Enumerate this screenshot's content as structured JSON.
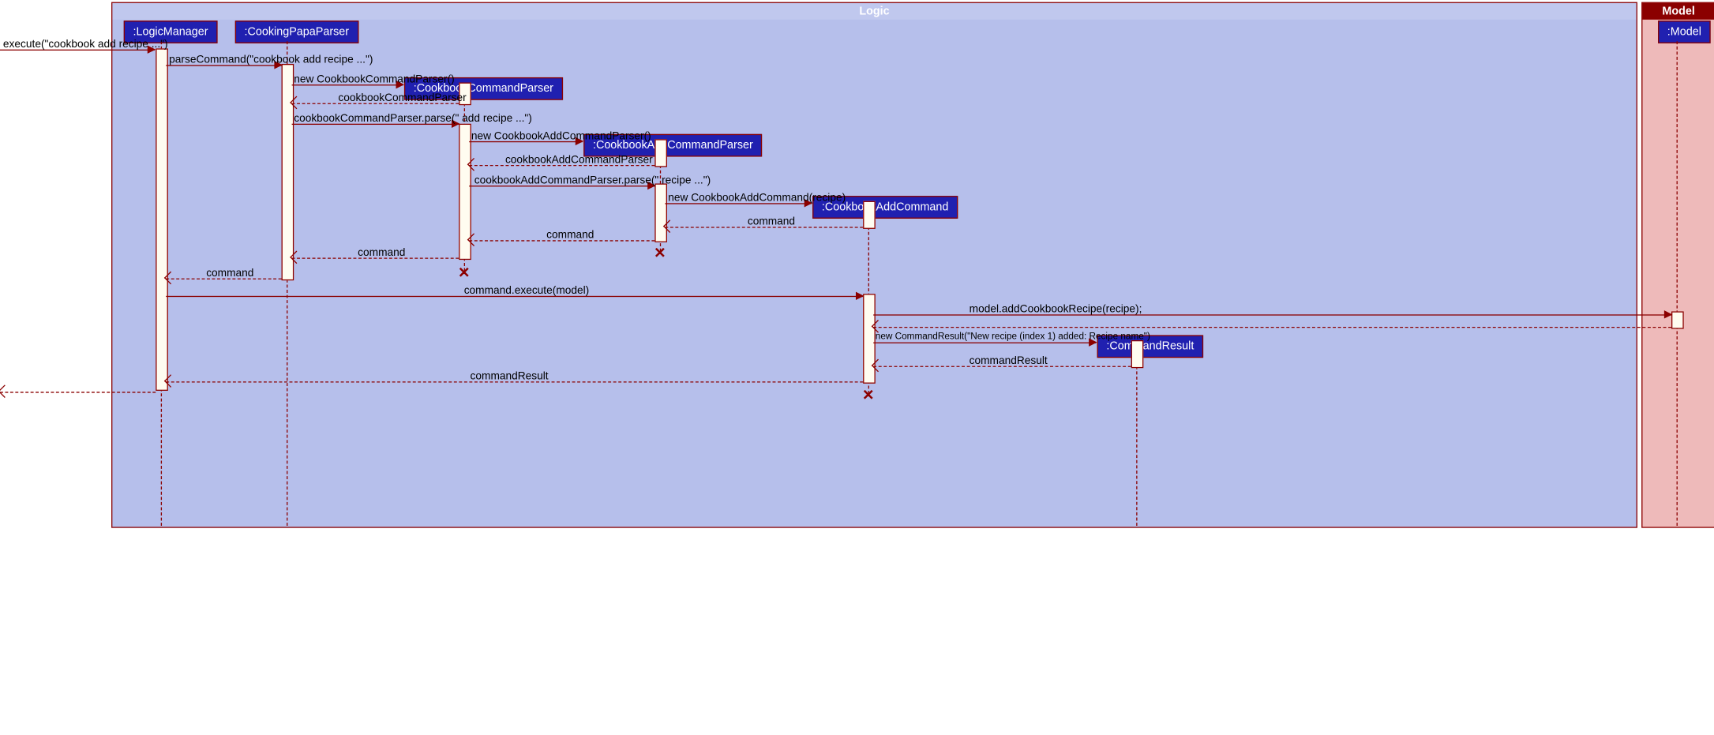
{
  "boxes": {
    "logic_title": "Logic",
    "model_title": "Model"
  },
  "heads": {
    "logicManager": ":LogicManager",
    "cookingPapaParser": ":CookingPapaParser",
    "cookbookCommandParser": ":CookbookCommandParser",
    "cookbookAddCommandParser": ":CookbookAddCommandParser",
    "cookbookAddCommand": ":CookbookAddCommand",
    "commandResult": ":CommandResult",
    "model": ":Model"
  },
  "msgs": {
    "m1": "execute(\"cookbook add recipe ...\")",
    "m2": "parseCommand(\"cookbook add recipe ...\")",
    "m3": "new CookbookCommandParser()",
    "m4": "cookbookCommandParser",
    "m5": "cookbookCommandParser.parse(\" add recipe ...\")",
    "m6": "new CookbookAddCommandParser()",
    "m7": "cookbookAddCommandParser",
    "m8": "cookbookAddCommandParser.parse(\" recipe ...\")",
    "m9": "new CookbookAddCommand(recipe)",
    "m10": "command",
    "m11": "command",
    "m12": "command",
    "m13": "command",
    "m14": "command.execute(model)",
    "m15": "model.addCookbookRecipe(recipe);",
    "m16": "new CommandResult(\"New recipe (index 1) added: Recipe name\")",
    "m17": "commandResult",
    "m18": "commandResult"
  },
  "chart_data": {
    "type": "sequence-diagram",
    "participants": [
      {
        "name": ":LogicManager",
        "box": "Logic"
      },
      {
        "name": ":CookingPapaParser",
        "box": "Logic"
      },
      {
        "name": ":CookbookCommandParser",
        "box": "Logic",
        "created_by_msg": 3,
        "destroyed_after_msg": 12
      },
      {
        "name": ":CookbookAddCommandParser",
        "box": "Logic",
        "created_by_msg": 6,
        "destroyed_after_msg": 11
      },
      {
        "name": ":CookbookAddCommand",
        "box": "Logic",
        "created_by_msg": 9,
        "destroyed_after_msg": 18
      },
      {
        "name": ":CommandResult",
        "box": "Logic",
        "created_by_msg": 16
      },
      {
        "name": ":Model",
        "box": "Model"
      }
    ],
    "messages": [
      {
        "n": 1,
        "from": "(external)",
        "to": ":LogicManager",
        "label": "execute(\"cookbook add recipe ...\")",
        "type": "sync"
      },
      {
        "n": 2,
        "from": ":LogicManager",
        "to": ":CookingPapaParser",
        "label": "parseCommand(\"cookbook add recipe ...\")",
        "type": "sync"
      },
      {
        "n": 3,
        "from": ":CookingPapaParser",
        "to": ":CookbookCommandParser",
        "label": "new CookbookCommandParser()",
        "type": "create"
      },
      {
        "n": 4,
        "from": ":CookbookCommandParser",
        "to": ":CookingPapaParser",
        "label": "cookbookCommandParser",
        "type": "return"
      },
      {
        "n": 5,
        "from": ":CookingPapaParser",
        "to": ":CookbookCommandParser",
        "label": "cookbookCommandParser.parse(\" add recipe ...\")",
        "type": "sync"
      },
      {
        "n": 6,
        "from": ":CookbookCommandParser",
        "to": ":CookbookAddCommandParser",
        "label": "new CookbookAddCommandParser()",
        "type": "create"
      },
      {
        "n": 7,
        "from": ":CookbookAddCommandParser",
        "to": ":CookbookCommandParser",
        "label": "cookbookAddCommandParser",
        "type": "return"
      },
      {
        "n": 8,
        "from": ":CookbookCommandParser",
        "to": ":CookbookAddCommandParser",
        "label": "cookbookAddCommandParser.parse(\" recipe ...\")",
        "type": "sync"
      },
      {
        "n": 9,
        "from": ":CookbookAddCommandParser",
        "to": ":CookbookAddCommand",
        "label": "new CookbookAddCommand(recipe)",
        "type": "create"
      },
      {
        "n": 10,
        "from": ":CookbookAddCommand",
        "to": ":CookbookAddCommandParser",
        "label": "command",
        "type": "return"
      },
      {
        "n": 11,
        "from": ":CookbookAddCommandParser",
        "to": ":CookbookCommandParser",
        "label": "command",
        "type": "return"
      },
      {
        "n": 12,
        "from": ":CookbookCommandParser",
        "to": ":CookingPapaParser",
        "label": "command",
        "type": "return"
      },
      {
        "n": 13,
        "from": ":CookingPapaParser",
        "to": ":LogicManager",
        "label": "command",
        "type": "return"
      },
      {
        "n": 14,
        "from": ":LogicManager",
        "to": ":CookbookAddCommand",
        "label": "command.execute(model)",
        "type": "sync"
      },
      {
        "n": 15,
        "from": ":CookbookAddCommand",
        "to": ":Model",
        "label": "model.addCookbookRecipe(recipe);",
        "type": "sync"
      },
      {
        "n": 16,
        "from": ":CookbookAddCommand",
        "to": ":CommandResult",
        "label": "new CommandResult(\"New recipe (index 1) added: Recipe name\")",
        "type": "create"
      },
      {
        "n": 17,
        "from": ":CommandResult",
        "to": ":CookbookAddCommand",
        "label": "commandResult",
        "type": "return"
      },
      {
        "n": 18,
        "from": ":CookbookAddCommand",
        "to": ":LogicManager",
        "label": "commandResult",
        "type": "return"
      }
    ]
  }
}
